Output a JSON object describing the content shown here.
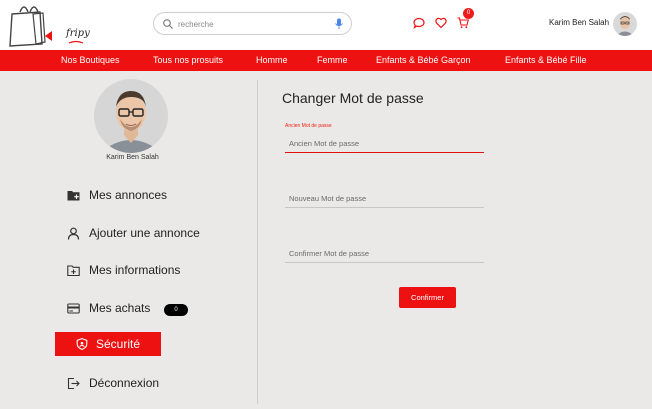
{
  "header": {
    "logo_text": "fripy",
    "search_placeholder": "recherche",
    "cart_count": "0",
    "user_name": "Karim Ben Salah"
  },
  "nav": {
    "items": [
      "Nos Boutiques",
      "Tous nos prosuits",
      "Homme",
      "Femme",
      "Enfants & Bébé Garçon",
      "Enfants & Bébé Fille"
    ]
  },
  "sidebar": {
    "user_name": "Karim Ben Salah",
    "items": [
      {
        "label": "Mes annonces",
        "icon": "folder-plus-icon"
      },
      {
        "label": "Ajouter une annonce",
        "icon": "user-icon"
      },
      {
        "label": "Mes informations",
        "icon": "folder-add-icon"
      },
      {
        "label": "Mes achats",
        "icon": "credit-card-icon",
        "badge": "0"
      },
      {
        "label": "Sécurité",
        "icon": "shield-icon",
        "active": true
      },
      {
        "label": "Déconnexion",
        "icon": "logout-icon"
      }
    ]
  },
  "form": {
    "title": "Changer Mot de passe",
    "old_password_label": "Ancien Mot de passe",
    "old_password_placeholder": "Ancien Mot de passe",
    "new_password_placeholder": "Nouveau Mot de passe",
    "confirm_password_placeholder": "Confirmer Mot de passe",
    "submit_label": "Confirmer"
  },
  "colors": {
    "accent": "#ee1111",
    "background": "#ebe9e8"
  }
}
